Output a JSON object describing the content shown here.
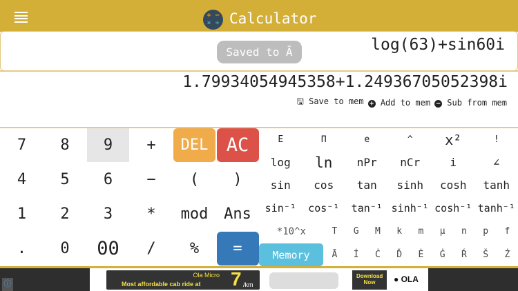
{
  "header": {
    "title": "Calculator",
    "logo_glyphs": [
      "+",
      "−",
      "×",
      "÷"
    ]
  },
  "display": {
    "expression": "log(63)+sin60i",
    "toast": "Saved to Ā",
    "result": "1.79934054945358+1.24936705052398i"
  },
  "memory_actions": [
    {
      "icon": "floppy-icon",
      "label": "Save to mem"
    },
    {
      "icon": "plus-circle-icon",
      "label": "Add to mem"
    },
    {
      "icon": "minus-circle-icon",
      "label": "Sub from mem"
    }
  ],
  "keypad": [
    [
      "7",
      "8",
      "9",
      "+",
      "DEL",
      "AC"
    ],
    [
      "4",
      "5",
      "6",
      "−",
      "(",
      ")"
    ],
    [
      "1",
      "2",
      "3",
      "*",
      "mod",
      "Ans"
    ],
    [
      ".",
      "0",
      "00",
      "/",
      "%",
      "="
    ]
  ],
  "sci": [
    [
      "E",
      "Π",
      "e",
      "^",
      "x²",
      "!"
    ],
    [
      "log",
      "ln",
      "nPr",
      "nCr",
      "i",
      "∠"
    ],
    [
      "sin",
      "cos",
      "tan",
      "sinh",
      "cosh",
      "tanh"
    ],
    [
      "sin⁻¹",
      "cos⁻¹",
      "tan⁻¹",
      "sinh⁻¹",
      "cosh⁻¹",
      "tanh⁻¹"
    ]
  ],
  "prefix_row": {
    "first": "*10^x",
    "keys": [
      "T",
      "G",
      "M",
      "k",
      "m",
      "μ",
      "n",
      "p",
      "f"
    ]
  },
  "memory_row": {
    "button": "Memory",
    "keys": [
      "Ā",
      "İ",
      "Ċ",
      "Ď",
      "Ė",
      "Ġ",
      "Ŕ",
      "Š",
      "Ż"
    ]
  },
  "ad": {
    "line1": "Ola Micro",
    "line2": "Most affordable cab ride at",
    "price": "7",
    "unit": "/km",
    "cta": "Download Now",
    "brand": "OLA"
  },
  "colors": {
    "accent": "#d4af37",
    "del": "#f0ab4b",
    "ac": "#dd5248",
    "equals": "#3579b8",
    "memory": "#5bc0de",
    "toast": "#bdbdbd"
  }
}
